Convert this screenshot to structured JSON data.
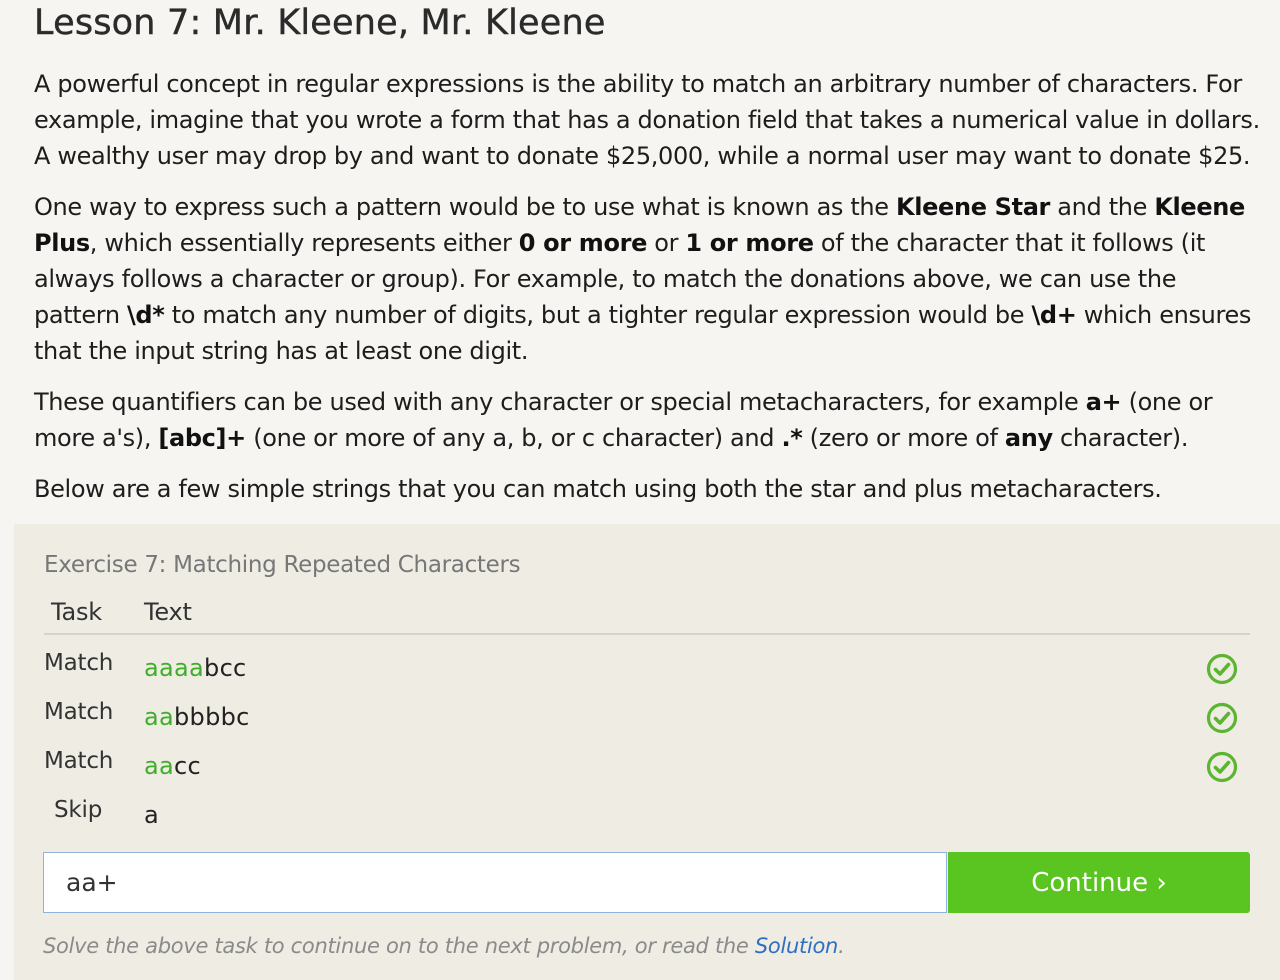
{
  "lesson": {
    "title": "Lesson 7: Mr. Kleene, Mr. Kleene",
    "p1": "A powerful concept in regular expressions is the ability to match an arbitrary number of characters. For example, imagine that you wrote a form that has a donation field that takes a numerical value in dollars. A wealthy user may drop by and want to donate $25,000, while a normal user may want to donate $25.",
    "p2": {
      "t1": "One way to express such a pattern would be to use what is known as the ",
      "b1": "Kleene Star",
      "t2": " and the ",
      "b2": "Kleene Plus",
      "t3": ", which essentially represents either ",
      "b3": "0 or more",
      "t4": " or ",
      "b4": "1 or more",
      "t5": " of the character that it follows (it always follows a character or group). For example, to match the donations above, we can use the pattern ",
      "b5": "\\d*",
      "t6": " to match any number of digits, but a tighter regular expression would be ",
      "b6": "\\d+",
      "t7": " which ensures that the input string has at least one digit."
    },
    "p3": {
      "t1": "These quantifiers can be used with any character or special metacharacters, for example ",
      "b1": "a+",
      "t2": " (one or more a's), ",
      "b2": "[abc]+",
      "t3": " (one or more of any a, b, or c character) and ",
      "b3": ".*",
      "t4": " (zero or more of ",
      "b4": "any",
      "t5": " character)."
    },
    "p4": "Below are a few simple strings that you can match using both the star and plus metacharacters."
  },
  "exercise": {
    "title": "Exercise 7: Matching Repeated Characters",
    "columns": {
      "task": "Task",
      "text": "Text"
    },
    "rows": [
      {
        "task": "Match",
        "matched": "aaaa",
        "rest": "bcc",
        "status": "check-icon"
      },
      {
        "task": "Match",
        "matched": "aa",
        "rest": "bbbbc",
        "status": "check-icon"
      },
      {
        "task": "Match",
        "matched": "aa",
        "rest": "cc",
        "status": "check-icon"
      },
      {
        "task": "Skip",
        "matched": "",
        "rest": "a",
        "status": ""
      }
    ],
    "input_value": "aa+",
    "continue_label": "Continue ›",
    "hint_text": "Solve the above task to continue on to the next problem, or read the ",
    "solution_link": "Solution",
    "hint_end": ".",
    "colors": {
      "match": "#3fae29",
      "button": "#5ac420",
      "link": "#2f6fc2",
      "check": "#5cb531"
    }
  }
}
